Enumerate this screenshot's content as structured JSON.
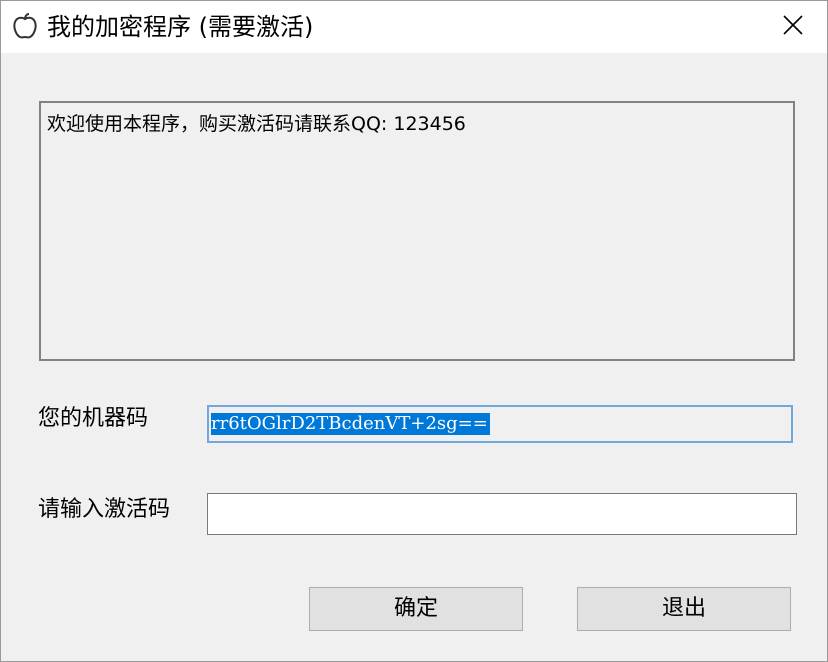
{
  "window": {
    "title": "我的加密程序  (需要激活)",
    "icon": "apple-icon",
    "close_icon": "close-icon"
  },
  "message": {
    "text": "欢迎使用本程序，购买激活码请联系QQ: 123456"
  },
  "machine_code": {
    "label": "您的机器码",
    "value": "rr6tOGlrD2TBcdenVT+2sg=="
  },
  "activation": {
    "label": "请输入激活码",
    "value": "",
    "placeholder": ""
  },
  "buttons": {
    "ok_label": "确定",
    "exit_label": "退出"
  },
  "colors": {
    "selection": "#0078d7",
    "focus_border": "#6fa8dc",
    "window_bg": "#f0f0f0"
  }
}
